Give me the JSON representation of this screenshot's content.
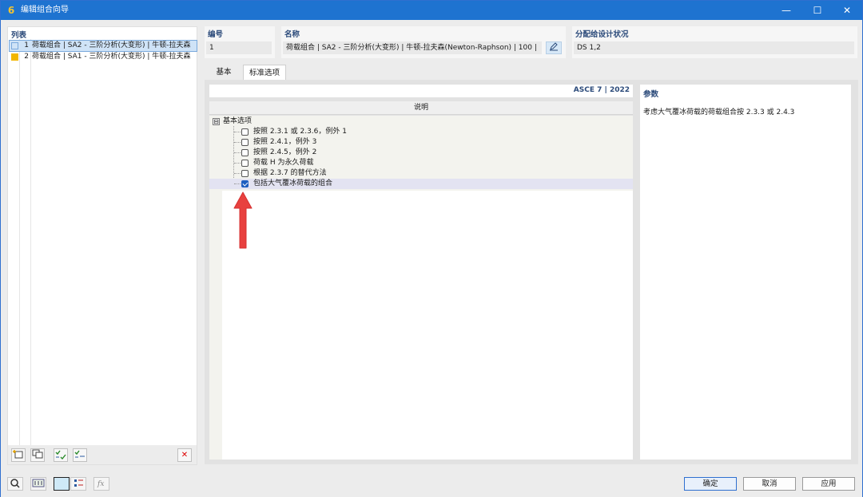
{
  "window": {
    "title": "编辑组合向导",
    "logo_glyph": "6",
    "controls": {
      "minimize": "—",
      "maximize": "☐",
      "close": "✕"
    }
  },
  "list": {
    "header": "列表",
    "items": [
      {
        "num": "1",
        "name": "荷载组合 | SA2 - 三阶分析(大变形) | 牛顿-拉夫森",
        "color": "#cfe3f7",
        "selected": true
      },
      {
        "num": "2",
        "name": "荷载组合 | SA1 - 三阶分析(大变形) | 牛顿-拉夫森",
        "color": "#f2b600",
        "selected": false
      }
    ],
    "toolbar": {
      "delete_glyph": "✕"
    }
  },
  "fields": {
    "number": {
      "label": "编号",
      "value": "1"
    },
    "name": {
      "label": "名称",
      "value": "荷载组合 | SA2 - 三阶分析(大变形) | 牛顿-拉夫森(Newton-Raphson) | 100 |"
    },
    "design_status": {
      "label": "分配给设计状况",
      "value": "DS 1,2"
    }
  },
  "tabs": [
    {
      "label": "基本",
      "active": false
    },
    {
      "label": "标准选项",
      "active": true
    }
  ],
  "standard": {
    "title": "ASCE 7 | 2022",
    "column_header": "说明",
    "group": {
      "label": "基本选项",
      "expander": "⊟"
    },
    "options": [
      {
        "label": "按照 2.3.1 或 2.3.6，例外 1",
        "checked": false
      },
      {
        "label": "按照 2.4.1，例外 3",
        "checked": false
      },
      {
        "label": "按照 2.4.5，例外 2",
        "checked": false
      },
      {
        "label": "荷载 H 为永久荷载",
        "checked": false
      },
      {
        "label": "根据 2.3.7 的替代方法",
        "checked": false
      },
      {
        "label": "包括大气覆冰荷载的组合",
        "checked": true
      }
    ]
  },
  "params": {
    "title": "参数",
    "text": "考虑大气覆冰荷载的荷载组合按 2.3.3 或 2.4.3"
  },
  "buttons": {
    "ok": "确定",
    "cancel": "取消",
    "apply": "应用"
  },
  "colors": {
    "titlebar": "#1e73d0",
    "accent_arrow": "#e8413f",
    "checkbox_checked": "#1e5fc0"
  }
}
